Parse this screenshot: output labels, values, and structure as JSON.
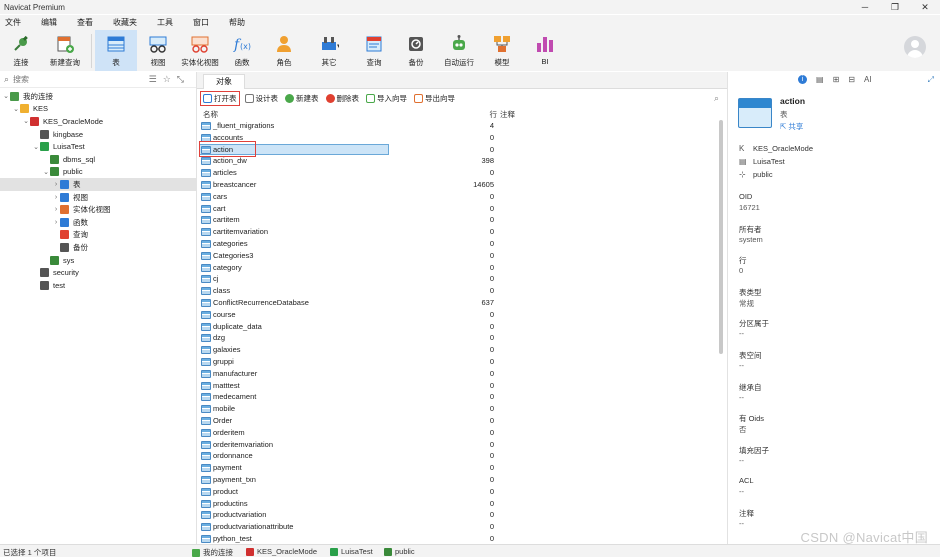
{
  "window": {
    "title": "Navicat Premium",
    "controls": [
      "─",
      "❐",
      "✕"
    ]
  },
  "menu": [
    "文件",
    "编辑",
    "查看",
    "收藏夹",
    "工具",
    "窗口",
    "帮助"
  ],
  "toolbar": {
    "buttons": [
      {
        "label": "连接",
        "icon": "connect-icon"
      },
      {
        "label": "新建查询",
        "icon": "new-query-icon"
      },
      {
        "label": "表",
        "icon": "table-icon",
        "active": true
      },
      {
        "label": "视图",
        "icon": "view-icon"
      },
      {
        "label": "实体化视图",
        "icon": "materialized-view-icon"
      },
      {
        "label": "函数",
        "icon": "function-icon"
      },
      {
        "label": "角色",
        "icon": "role-icon"
      },
      {
        "label": "其它",
        "icon": "others-icon"
      },
      {
        "label": "查询",
        "icon": "query-icon"
      },
      {
        "label": "备份",
        "icon": "backup-icon"
      },
      {
        "label": "自动运行",
        "icon": "automation-icon"
      },
      {
        "label": "模型",
        "icon": "model-icon"
      },
      {
        "label": "BI",
        "icon": "bi-icon"
      }
    ]
  },
  "sidebar": {
    "search_placeholder": "搜索",
    "tree": [
      {
        "label": "我的连接",
        "level": 0,
        "arrow": "⌄",
        "icon": "connections-icon"
      },
      {
        "label": "KES",
        "level": 1,
        "arrow": "⌄",
        "icon": "folder-icon"
      },
      {
        "label": "KES_OracleMode",
        "level": 2,
        "arrow": "⌄",
        "icon": "kes-server-icon"
      },
      {
        "label": "kingbase",
        "level": 3,
        "arrow": "",
        "icon": "database-icon"
      },
      {
        "label": "LuisaTest",
        "level": 3,
        "arrow": "⌄",
        "icon": "database-open-icon"
      },
      {
        "label": "dbms_sql",
        "level": 4,
        "arrow": "",
        "icon": "schema-icon"
      },
      {
        "label": "public",
        "level": 4,
        "arrow": "⌄",
        "icon": "schema-icon"
      },
      {
        "label": "表",
        "level": 5,
        "arrow": "›",
        "icon": "table-icon",
        "selected": true
      },
      {
        "label": "视图",
        "level": 5,
        "arrow": "›",
        "icon": "view-icon"
      },
      {
        "label": "实体化视图",
        "level": 5,
        "arrow": "›",
        "icon": "materialized-view-icon"
      },
      {
        "label": "函数",
        "level": 5,
        "arrow": "›",
        "icon": "function-icon"
      },
      {
        "label": "查询",
        "level": 5,
        "arrow": "",
        "icon": "query-icon"
      },
      {
        "label": "备份",
        "level": 5,
        "arrow": "",
        "icon": "backup-icon"
      },
      {
        "label": "sys",
        "level": 4,
        "arrow": "",
        "icon": "schema-icon"
      },
      {
        "label": "security",
        "level": 3,
        "arrow": "",
        "icon": "database-icon"
      },
      {
        "label": "test",
        "level": 3,
        "arrow": "",
        "icon": "database-icon"
      }
    ]
  },
  "tabs": {
    "objects": "对象"
  },
  "object_toolbar": {
    "open_table": "打开表",
    "design_table": "设计表",
    "new_table": "新建表",
    "delete_table": "删除表",
    "import_wizard": "导入向导",
    "export_wizard": "导出向导"
  },
  "table_list": {
    "columns": {
      "name": "名称",
      "rows": "行",
      "comment": "注释"
    },
    "selected": "action",
    "rows": [
      {
        "name": "_fluent_migrations",
        "rows": "4"
      },
      {
        "name": "accounts",
        "rows": "0"
      },
      {
        "name": "action",
        "rows": "0"
      },
      {
        "name": "action_dw",
        "rows": "398"
      },
      {
        "name": "articles",
        "rows": "0"
      },
      {
        "name": "breastcancer",
        "rows": "14605"
      },
      {
        "name": "cars",
        "rows": "0"
      },
      {
        "name": "cart",
        "rows": "0"
      },
      {
        "name": "cartitem",
        "rows": "0"
      },
      {
        "name": "cartitemvariation",
        "rows": "0"
      },
      {
        "name": "categories",
        "rows": "0"
      },
      {
        "name": "Categories3",
        "rows": "0"
      },
      {
        "name": "category",
        "rows": "0"
      },
      {
        "name": "cj",
        "rows": "0"
      },
      {
        "name": "class",
        "rows": "0"
      },
      {
        "name": "ConflictRecurrenceDatabase",
        "rows": "637"
      },
      {
        "name": "course",
        "rows": "0"
      },
      {
        "name": "duplicate_data",
        "rows": "0"
      },
      {
        "name": "dzg",
        "rows": "0"
      },
      {
        "name": "galaxies",
        "rows": "0"
      },
      {
        "name": "gruppi",
        "rows": "0"
      },
      {
        "name": "manufacturer",
        "rows": "0"
      },
      {
        "name": "matttest",
        "rows": "0"
      },
      {
        "name": "medecament",
        "rows": "0"
      },
      {
        "name": "mobile",
        "rows": "0"
      },
      {
        "name": "Order",
        "rows": "0"
      },
      {
        "name": "orderitem",
        "rows": "0"
      },
      {
        "name": "orderitemvariation",
        "rows": "0"
      },
      {
        "name": "ordonnance",
        "rows": "0"
      },
      {
        "name": "payment",
        "rows": "0"
      },
      {
        "name": "payment_txn",
        "rows": "0"
      },
      {
        "name": "product",
        "rows": "0"
      },
      {
        "name": "productins",
        "rows": "0"
      },
      {
        "name": "productvariation",
        "rows": "0"
      },
      {
        "name": "productvariationattribute",
        "rows": "0"
      },
      {
        "name": "python_test",
        "rows": "0"
      }
    ]
  },
  "info_panel": {
    "name": "action",
    "type": "表",
    "share": "共享",
    "connection": "KES_OracleMode",
    "database": "LuisaTest",
    "schema": "public",
    "fields": [
      {
        "label": "OID",
        "value": "16721"
      },
      {
        "label": "所有者",
        "value": "system"
      },
      {
        "label": "行",
        "value": "0"
      },
      {
        "label": "表类型",
        "value": "常规"
      },
      {
        "label": "分区属于",
        "value": "--"
      },
      {
        "label": "表空间",
        "value": "--"
      },
      {
        "label": "继承自",
        "value": "--"
      },
      {
        "label": "有 Oids",
        "value": "否"
      },
      {
        "label": "填充因子",
        "value": "--"
      },
      {
        "label": "ACL",
        "value": "--"
      },
      {
        "label": "注释",
        "value": "--"
      }
    ]
  },
  "status": {
    "selection": "已选择 1 个项目",
    "breadcrumb": [
      "我的连接",
      "KES_OracleMode",
      "LuisaTest",
      "public"
    ]
  },
  "watermark": "CSDN @Navicat中国"
}
